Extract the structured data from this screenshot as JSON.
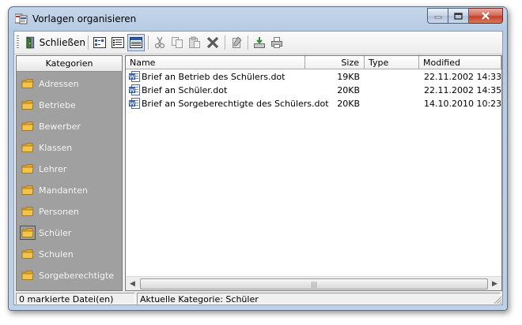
{
  "window": {
    "title": "Vorlagen organisieren"
  },
  "toolbar": {
    "close_label": "Schließen",
    "buttons": [
      "close-icon",
      "list-view-icon",
      "details-view-icon",
      "report-view-icon",
      "cut-icon",
      "copy-icon",
      "paste-icon",
      "delete-icon",
      "edit-icon",
      "import-icon",
      "print-icon"
    ]
  },
  "categories": {
    "header": "Kategorien",
    "items": [
      "Adressen",
      "Betriebe",
      "Bewerber",
      "Klassen",
      "Lehrer",
      "Mandanten",
      "Personen",
      "Schüler",
      "Schulen",
      "Sorgeberechtigte"
    ],
    "selected": "Schüler"
  },
  "files": {
    "columns": {
      "name": "Name",
      "size": "Size",
      "type": "Type",
      "modified": "Modified"
    },
    "rows": [
      {
        "name": "Brief an Betrieb des Schülers.dot",
        "size": "19KB",
        "type": "",
        "modified": "22.11.2002 14:33"
      },
      {
        "name": "Brief an Schüler.dot",
        "size": "20KB",
        "type": "",
        "modified": "22.11.2002 14:35"
      },
      {
        "name": "Brief an Sorgeberechtigte des Schülers.dot",
        "size": "20KB",
        "type": "",
        "modified": "14.10.2010 10:23"
      }
    ]
  },
  "status": {
    "selected_count": "0 markierte Datei(en)",
    "current_category": "Aktuelle Kategorie: Schüler"
  },
  "colors": {
    "pane_bg": "#a0a0a0",
    "folder": "#f2c44d",
    "word_blue": "#2a5aa8"
  }
}
